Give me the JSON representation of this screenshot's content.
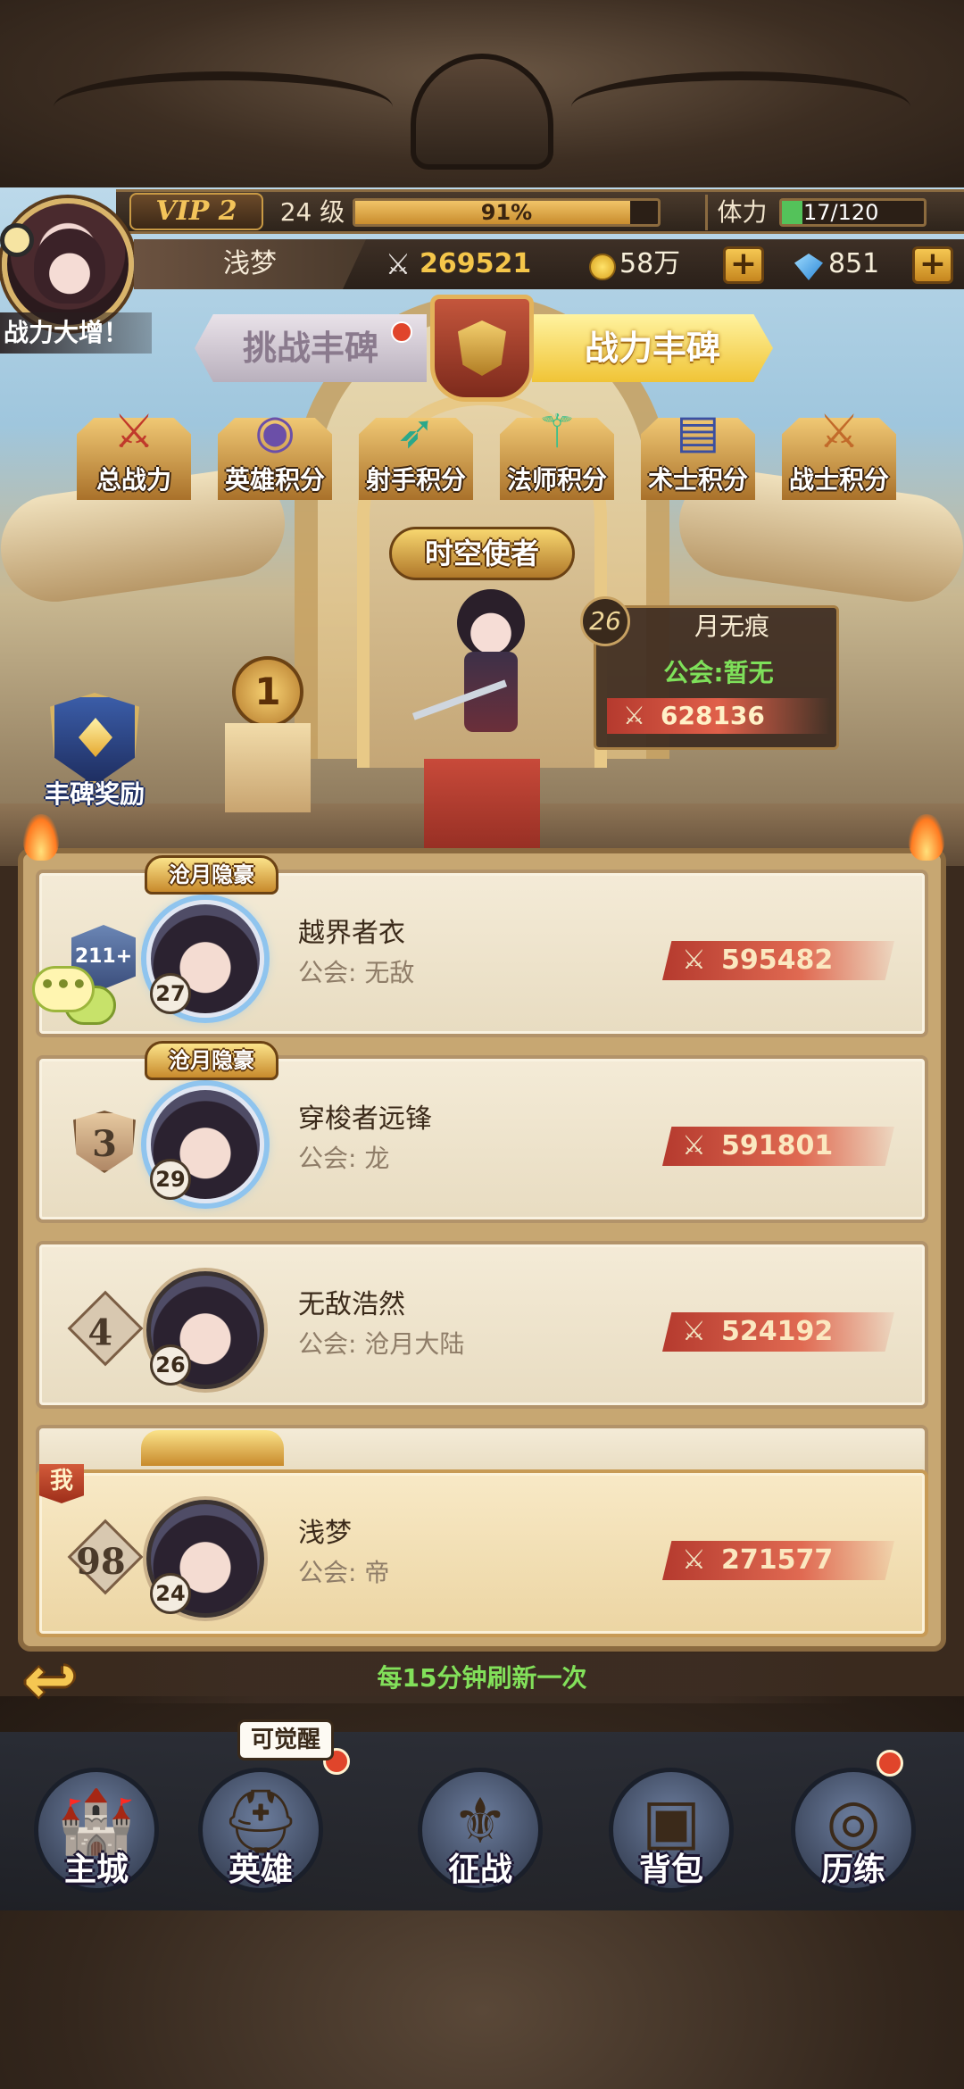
{
  "colors": {
    "accent_gold": "#f4c64a",
    "power_red": "#b53a2e",
    "guild_green": "#7ee05a",
    "notice_red": "#e0452b"
  },
  "hud": {
    "power_up_text": "战力大增！",
    "vip": "VIP 2",
    "level": "24 级",
    "exp_percent_text": "91%",
    "exp_fraction": 0.91,
    "stamina_label": "体力",
    "stamina": "17/120",
    "stamina_fraction": 0.1417,
    "player_name": "浅梦",
    "power": "269521",
    "gold": "58万",
    "gems": "851",
    "plus": "+"
  },
  "tabs": {
    "challenge": "挑战丰碑",
    "power": "战力丰碑"
  },
  "categories": [
    {
      "label": "总战力",
      "icon": "crossed-swords-icon",
      "glyph": "⚔",
      "color": "#c0392b"
    },
    {
      "label": "英雄积分",
      "icon": "hero-helmet-icon",
      "glyph": "◉",
      "color": "#6b4fa8"
    },
    {
      "label": "射手积分",
      "icon": "bow-icon",
      "glyph": "➶",
      "color": "#2aa88a"
    },
    {
      "label": "法师积分",
      "icon": "staff-icon",
      "glyph": "⚚",
      "color": "#3cbf8a"
    },
    {
      "label": "术士积分",
      "icon": "tome-icon",
      "glyph": "▤",
      "color": "#3b4fa0"
    },
    {
      "label": "战士积分",
      "icon": "greatsword-icon",
      "glyph": "⚔",
      "color": "#c26a2a"
    }
  ],
  "champion": {
    "title": "时空使者",
    "rank": "1",
    "level": "26",
    "name": "月无痕",
    "guild": "公会:暂无",
    "power": "628136"
  },
  "reward_button": "丰碑奖励",
  "ranking": [
    {
      "rank_badge": "211+",
      "title": "沧月隐豪",
      "level": "27",
      "name": "越界者衣",
      "guild": "公会: 无敌",
      "power": "595482"
    },
    {
      "rank": "3",
      "title": "沧月隐豪",
      "level": "29",
      "name": "穿梭者远锋",
      "guild": "公会: 龙",
      "power": "591801"
    },
    {
      "rank": "4",
      "title": "",
      "level": "26",
      "name": "无敌浩然",
      "guild": "公会: 沧月大陆",
      "power": "524192"
    }
  ],
  "peek_title": "时空使者",
  "me": {
    "tag": "我",
    "rank": "98",
    "level": "24",
    "name": "浅梦",
    "guild": "公会: 帝",
    "power": "271577"
  },
  "chat_bubble": "•••",
  "refresh_text": "每15分钟刷新一次",
  "nav": {
    "awaken_tag": "可觉醒",
    "items": [
      {
        "label": "主城",
        "icon": "castle-icon",
        "glyph": "🏰"
      },
      {
        "label": "英雄",
        "icon": "golden-helmet-icon",
        "glyph": "⛑"
      },
      {
        "label": "征战",
        "icon": "battle-shield-icon",
        "glyph": "⚜"
      },
      {
        "label": "背包",
        "icon": "treasure-chest-icon",
        "glyph": "▣"
      },
      {
        "label": "历练",
        "icon": "portal-icon",
        "glyph": "◎"
      }
    ]
  }
}
